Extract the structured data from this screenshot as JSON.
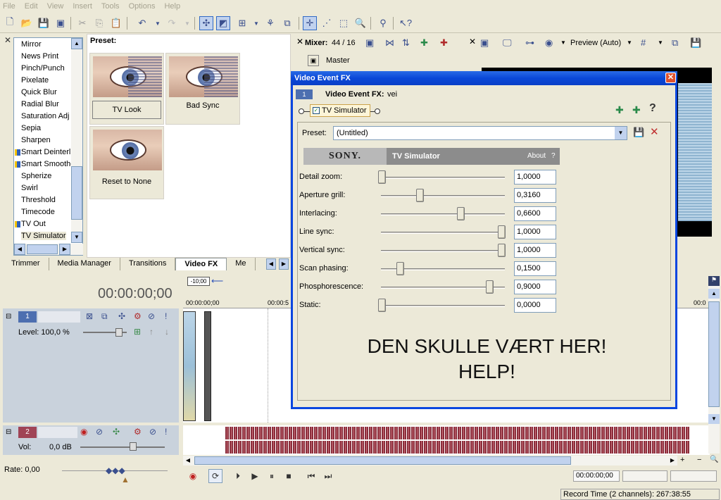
{
  "menu": [
    "File",
    "Edit",
    "View",
    "Insert",
    "Tools",
    "Options",
    "Help"
  ],
  "fx_list": [
    "Mirror",
    "News Print",
    "Pinch/Punch",
    "Pixelate",
    "Quick Blur",
    "Radial Blur",
    "Saturation Adj",
    "Sepia",
    "Sharpen",
    "Smart Deinterl",
    "Smart Smoothe",
    "Spherize",
    "Swirl",
    "Threshold",
    "Timecode",
    "TV Out",
    "TV Simulator"
  ],
  "preset_panel": {
    "heading": "Preset:",
    "items": [
      "TV Look",
      "Bad Sync",
      "Reset to None"
    ]
  },
  "tabs": [
    "Trimmer",
    "Media Manager",
    "Transitions",
    "Video FX",
    "Me"
  ],
  "mixer": {
    "label": "Mixer:",
    "count": "44 / 16",
    "master": "Master"
  },
  "preview": {
    "label": "Preview (Auto)"
  },
  "timecode_main": "00:00:00;00",
  "timeline": {
    "marker": "-10;00",
    "ruler_start": "00:00:00;00",
    "ruler_mid": "00:00:5",
    "ruler_end": "00:0"
  },
  "video_track": {
    "number": "1",
    "level": "Level: 100,0 %"
  },
  "audio_track": {
    "number": "2",
    "vol_label": "Vol:",
    "vol_value": "0,0 dB"
  },
  "rate": "Rate: 0,00",
  "transport_time": "00:00:00;00",
  "status": "Record Time (2 channels): 267:38:55",
  "dialog": {
    "title": "Video Event FX",
    "header_num": "1",
    "header_label": "Video Event FX:",
    "header_value": "vei",
    "chain_item": "TV Simulator",
    "help_glyph": "?",
    "preset_label": "Preset:",
    "preset_value": "(Untitled)",
    "brand": "SONY.",
    "plugin_name": "TV Simulator",
    "about": "About",
    "about_q": "?",
    "params": [
      {
        "label": "Detail zoom:",
        "value": "1,0000",
        "pos": 0.0
      },
      {
        "label": "Aperture grill:",
        "value": "0,3160",
        "pos": 0.316
      },
      {
        "label": "Interlacing:",
        "value": "0,6600",
        "pos": 0.66
      },
      {
        "label": "Line sync:",
        "value": "1,0000",
        "pos": 1.0
      },
      {
        "label": "Vertical sync:",
        "value": "1,0000",
        "pos": 1.0
      },
      {
        "label": "Scan phasing:",
        "value": "0,1500",
        "pos": 0.15
      },
      {
        "label": "Phosphorescence:",
        "value": "0,9000",
        "pos": 0.9
      },
      {
        "label": "Static:",
        "value": "0,0000",
        "pos": 0.0
      }
    ],
    "message_line1": "DEN SKULLE VÆRT HER!",
    "message_line2": "HELP!"
  }
}
